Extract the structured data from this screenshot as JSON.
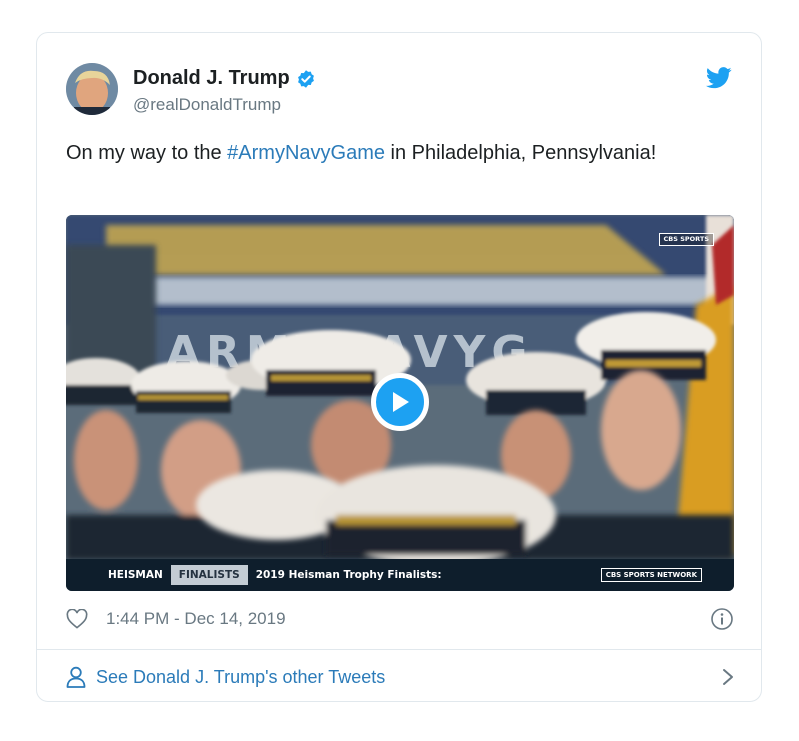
{
  "tweet": {
    "author_name": "Donald J. Trump",
    "handle": "@realDonaldTrump",
    "text_before": "On my way to the ",
    "hashtag": "#ArmyNavyGame",
    "text_after": " in Philadelphia, Pennsylvania!",
    "timestamp": "1:44 PM - Dec 14, 2019"
  },
  "media": {
    "scoreboard": {
      "badge_tag": "HEISMAN",
      "badge_finalists": "FINALISTS",
      "caption": "2019 Heisman Trophy Finalists:",
      "network_logo": "CBS SPORTS NETWORK"
    },
    "corner_logo": "CBS SPORTS",
    "banner_text": "ARMYNAVYG"
  },
  "footer": {
    "see_more": "See Donald J. Trump's other Tweets"
  },
  "colors": {
    "link": "#2b7bb9",
    "verified": "#1da1f2",
    "muted": "#697882",
    "border": "#e1e8ed"
  },
  "icons": [
    "verified-badge-icon",
    "twitter-bird-icon",
    "play-icon",
    "heart-icon",
    "info-icon",
    "user-icon",
    "chevron-right-icon"
  ]
}
